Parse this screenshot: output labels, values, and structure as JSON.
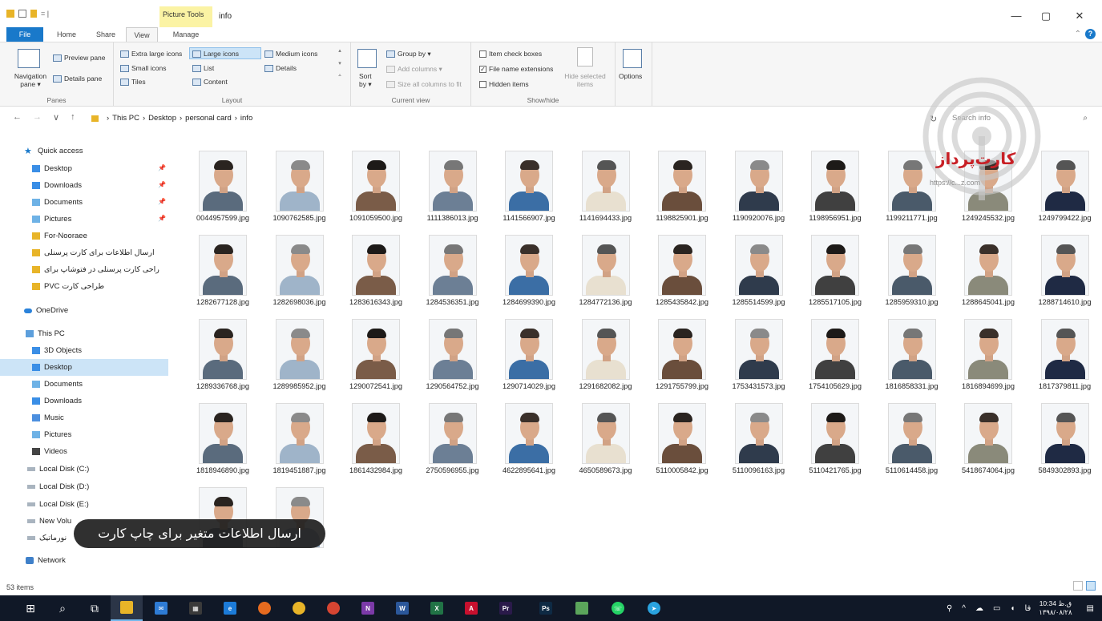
{
  "window": {
    "context_tab": "Picture Tools",
    "title": "info",
    "qat_glyph": "= |",
    "min_glyph": "—",
    "max_glyph": "▢",
    "close_glyph": "✕"
  },
  "ribbon_tabs": [
    "File",
    "Home",
    "Share",
    "View",
    "Manage"
  ],
  "ribbon": {
    "panes": {
      "label": "Panes",
      "navigation_pane": "Navigation pane ▾",
      "preview_pane": "Preview pane",
      "details_pane": "Details pane"
    },
    "layout": {
      "label": "Layout",
      "extra_large": "Extra large icons",
      "large": "Large icons",
      "medium": "Medium icons",
      "small": "Small icons",
      "list": "List",
      "details": "Details",
      "tiles": "Tiles",
      "content": "Content"
    },
    "current_view": {
      "label": "Current view",
      "sort_by": "Sort by ▾",
      "group_by": "Group by ▾",
      "add_columns": "Add columns ▾",
      "size_columns": "Size all columns to fit"
    },
    "show_hide": {
      "label": "Show/hide",
      "item_checkboxes": "Item check boxes",
      "file_extensions": "File name extensions",
      "hidden_items": "Hidden items",
      "hide_selected": "Hide selected items",
      "options": "Options"
    }
  },
  "address": {
    "breadcrumb": [
      "This PC",
      "Desktop",
      "personal card",
      "info"
    ],
    "separator": "›",
    "search_placeholder": "Search info",
    "nav_back": "←",
    "nav_forward": "→",
    "nav_recent": "∨",
    "nav_up": "↑",
    "refresh": "↻",
    "search_icon": "⌕"
  },
  "sidebar": {
    "quick_access": "Quick access",
    "qa_items": [
      "Desktop",
      "Downloads",
      "Documents",
      "Pictures",
      "For-Nooraee",
      "ارسال اطلاعات برای کارت پرسنلی",
      "راحی کارت پرسنلی در فتوشاپ برای",
      "PVC طراحی کارت"
    ],
    "onedrive": "OneDrive",
    "this_pc": "This PC",
    "pc_items": [
      "3D Objects",
      "Desktop",
      "Documents",
      "Downloads",
      "Music",
      "Pictures",
      "Videos",
      "Local Disk (C:)",
      "Local Disk (D:)",
      "Local Disk (E:)",
      "New Volu",
      "نورماتیک"
    ],
    "network": "Network"
  },
  "files": [
    "0044957599.jpg",
    "1090762585.jpg",
    "1091059500.jpg",
    "1111386013.jpg",
    "1141566907.jpg",
    "1141694433.jpg",
    "1198825901.jpg",
    "1190920076.jpg",
    "1198956951.jpg",
    "1199211771.jpg",
    "1249245532.jpg",
    "1249799422.jpg",
    "1282677128.jpg",
    "1282698036.jpg",
    "1283616343.jpg",
    "1284536351.jpg",
    "1284699390.jpg",
    "1284772136.jpg",
    "1285435842.jpg",
    "1285514599.jpg",
    "1285517105.jpg",
    "1285959310.jpg",
    "1288645041.jpg",
    "1288714610.jpg",
    "1289336768.jpg",
    "1289985952.jpg",
    "1290072541.jpg",
    "1290564752.jpg",
    "1290714029.jpg",
    "1291682082.jpg",
    "1291755799.jpg",
    "1753431573.jpg",
    "1754105629.jpg",
    "1816858331.jpg",
    "1816894699.jpg",
    "1817379811.jpg",
    "1818946890.jpg",
    "1819451887.jpg",
    "1861432984.jpg",
    "2750596955.jpg",
    "4622895641.jpg",
    "4650589673.jpg",
    "5110005842.jpg",
    "5110096163.jpg",
    "5110421765.jpg",
    "5110614458.jpg",
    "5418674064.jpg",
    "5849302893.jpg",
    "",
    ""
  ],
  "watermark": {
    "brand": "کارت‌پرداز",
    "url": "https://c...z.com"
  },
  "caption": "ارسال اطلاعات متغیر برای چاپ کارت",
  "status": {
    "items": "53 items"
  },
  "taskbar": {
    "apps": [
      "start",
      "search",
      "task-view",
      "file-explorer",
      "mail",
      "calculator",
      "edge",
      "firefox",
      "chrome",
      "chrome-alt",
      "onenote",
      "word",
      "excel",
      "acrobat",
      "premiere",
      "photoshop",
      "notepad",
      "whatsapp",
      "telegram"
    ],
    "clock_time": "10:34 ق.ظ",
    "clock_date": "۱۳۹۸/۰۸/۲۸",
    "lang": "فا"
  },
  "colors": {
    "accent": "#1979ca",
    "selection": "#cce4f7",
    "taskbar": "#101827",
    "watermark_red": "#c81f25"
  }
}
